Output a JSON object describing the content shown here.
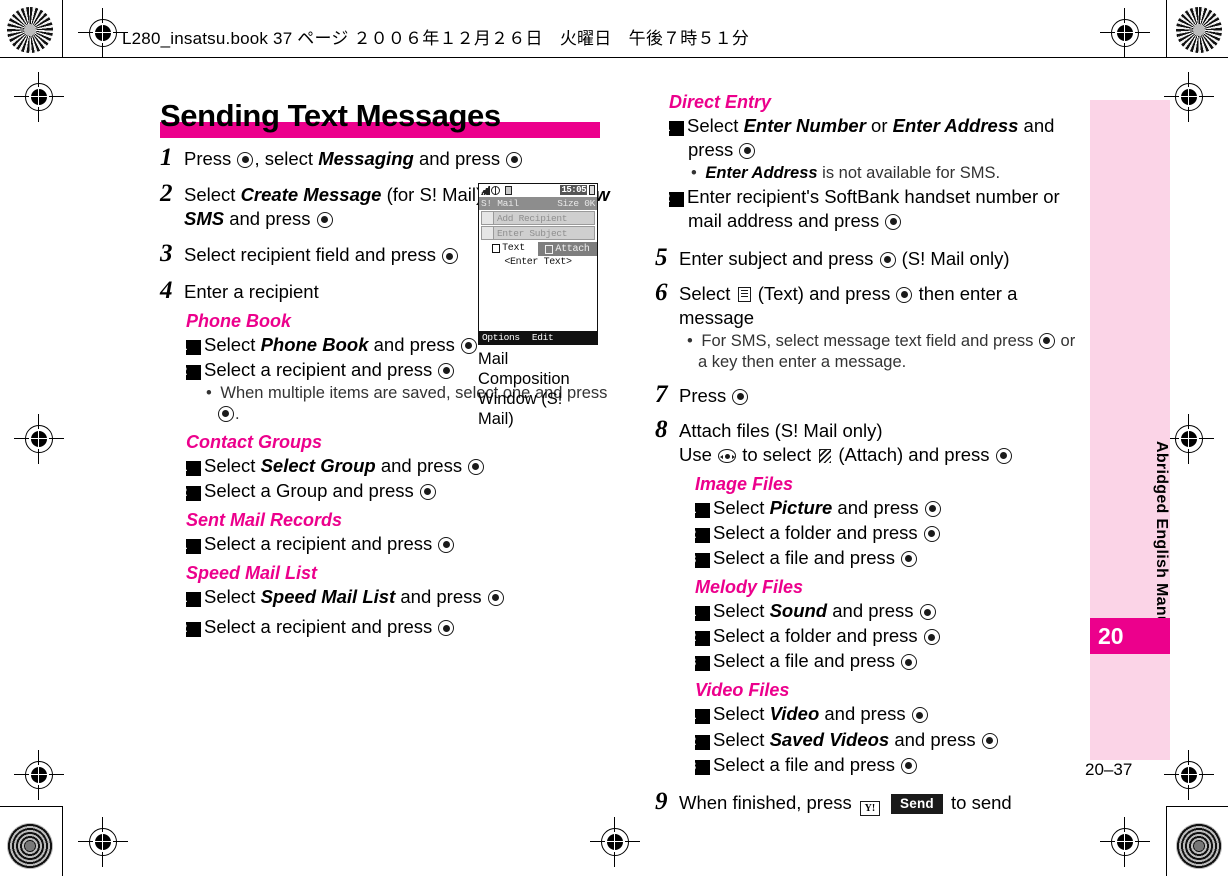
{
  "header": {
    "slug": "L280_insatsu.book 37 ページ ２００６年１２月２６日　火曜日　午後７時５１分"
  },
  "page": {
    "title": "Sending Text Messages",
    "folio": "20–37",
    "sidebar_label": "Abridged English Manual",
    "chapter_number": "20"
  },
  "colors": {
    "accent_magenta": "#ec008c",
    "tab_pink": "#fbd4e7",
    "text_black": "#000000"
  },
  "left_column": {
    "steps": [
      {
        "num": "1",
        "parts": [
          "Press ",
          "KEY",
          ", select ",
          "Messaging",
          " and press ",
          "KEY"
        ],
        "text": "Press (●), select Messaging and press (●)"
      },
      {
        "num": "2",
        "text": "Select Create Message (for S! Mail) or Create New SMS and press (●)"
      },
      {
        "num": "3",
        "text": "Select recipient field and press (●)"
      },
      {
        "num": "4",
        "text": "Enter a recipient"
      }
    ],
    "step1": {
      "a": "Press",
      "b": ", select",
      "italic": "Messaging",
      "c": "and press"
    },
    "step2": {
      "a": "Select",
      "italic1": "Create Message",
      "b": "(for S! Mail) or",
      "italic2": "Create New SMS",
      "c": "and press"
    },
    "step3": {
      "a": "Select recipient field and press"
    },
    "step4": {
      "a": "Enter a recipient"
    },
    "subsections": [
      {
        "heading": "Phone Book",
        "items": [
          {
            "n": "1",
            "a": "Select",
            "italic": "Phone Book",
            "b": "and press"
          },
          {
            "n": "2",
            "a": "Select a recipient and press",
            "italic": "",
            "b": ""
          }
        ],
        "bullet": "When multiple items are saved, select one and press"
      },
      {
        "heading": "Contact Groups",
        "items": [
          {
            "n": "1",
            "a": "Select",
            "italic": "Select Group",
            "b": "and press"
          },
          {
            "n": "2",
            "a": "Select a Group and press",
            "italic": "",
            "b": ""
          }
        ]
      },
      {
        "heading": "Sent Mail Records",
        "items": [
          {
            "n": "1",
            "a": "Select a recipient and press",
            "italic": "",
            "b": ""
          }
        ]
      },
      {
        "heading": "Speed Mail List",
        "items": [
          {
            "n": "1",
            "a": "Select",
            "italic": "Speed Mail List",
            "b": "and press"
          },
          {
            "n": "2",
            "a": "Select a recipient and press",
            "italic": "",
            "b": ""
          }
        ]
      }
    ]
  },
  "screenshot": {
    "caption_line1": "Mail Composition",
    "caption_line2": "Window (S! Mail)",
    "status_time": "15:05",
    "title_left": "S! Mail",
    "title_right": "Size 0K",
    "field_recipient": "Add Recipient",
    "field_subject": "Enter Subject",
    "tab_text": "Text",
    "tab_attach": "Attach",
    "body_placeholder": "<Enter Text>",
    "softkey_left": "Options",
    "softkey_right": "Edit"
  },
  "right_column": {
    "direct_entry": {
      "heading": "Direct Entry",
      "item1_a": "Select",
      "item1_italic1": "Enter Number",
      "item1_mid": "or",
      "item1_italic2": "Enter Address",
      "item1_b": "and press",
      "bullet_italic": "Enter Address",
      "bullet_rest": "is not available for SMS.",
      "item2": "Enter recipient's SoftBank handset number or mail address and press"
    },
    "step5": {
      "num": "5",
      "text": "Enter subject and press",
      "tail": "(S! Mail only)"
    },
    "step6": {
      "num": "6",
      "a": "Select",
      "icon_label": "(Text)",
      "b": "and press",
      "c": "then enter a message",
      "bullet_a": "For SMS, select message text field and press",
      "bullet_b": "or a key then enter a message."
    },
    "step7": {
      "num": "7",
      "text": "Press"
    },
    "step8": {
      "num": "8",
      "line1": "Attach files (S! Mail only)",
      "line2_a": "Use",
      "line2_b": "to select",
      "line2_c": "(Attach) and press",
      "groups": [
        {
          "heading": "Image Files",
          "items": [
            {
              "n": "1",
              "a": "Select",
              "italic": "Picture",
              "b": "and press"
            },
            {
              "n": "2",
              "a": "Select a folder and press",
              "italic": "",
              "b": ""
            },
            {
              "n": "3",
              "a": "Select a file and press",
              "italic": "",
              "b": ""
            }
          ]
        },
        {
          "heading": "Melody Files",
          "items": [
            {
              "n": "1",
              "a": "Select",
              "italic": "Sound",
              "b": "and press"
            },
            {
              "n": "2",
              "a": "Select a folder and press",
              "italic": "",
              "b": ""
            },
            {
              "n": "3",
              "a": "Select a file and press",
              "italic": "",
              "b": ""
            }
          ]
        },
        {
          "heading": "Video Files",
          "items": [
            {
              "n": "1",
              "a": "Select",
              "italic": "Video",
              "b": "and press"
            },
            {
              "n": "2",
              "a": "Select",
              "italic": "Saved Videos",
              "b": "and press"
            },
            {
              "n": "3",
              "a": "Select a file and press",
              "italic": "",
              "b": ""
            }
          ]
        }
      ]
    },
    "step9": {
      "num": "9",
      "a": "When finished, press",
      "softkey_y": "Y!",
      "send_label": "Send",
      "b": "to send"
    }
  }
}
